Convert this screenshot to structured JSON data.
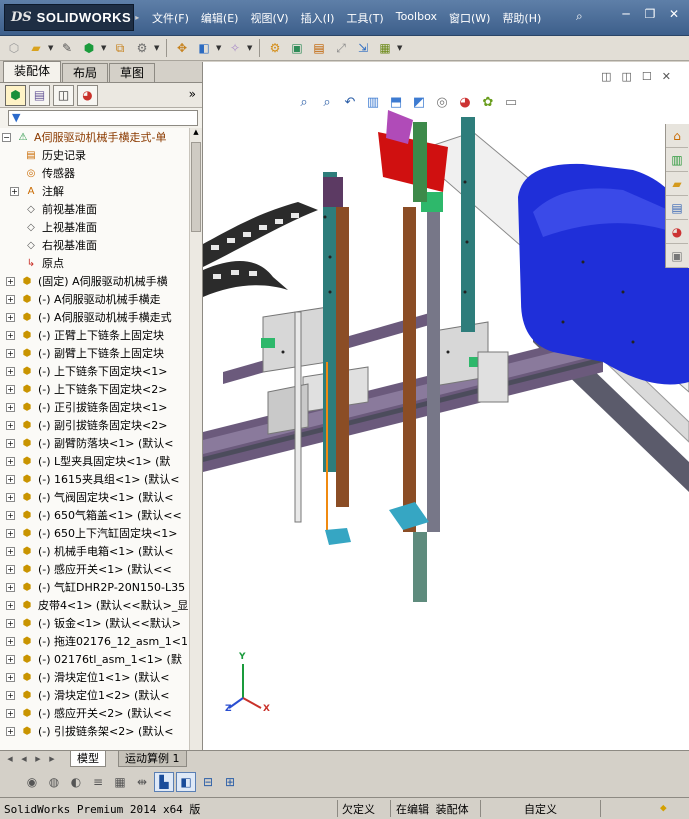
{
  "app": {
    "logo_ds": "DS",
    "logo_text": "SOLIDWORKS"
  },
  "menu": [
    "文件(F)",
    "编辑(E)",
    "视图(V)",
    "插入(I)",
    "工具(T)",
    "Toolbox",
    "窗口(W)",
    "帮助(H)"
  ],
  "panel": {
    "tabs": [
      "装配体",
      "布局",
      "草图"
    ],
    "active_tab": "装配体",
    "filter_icon": "filter-icon",
    "more": "»"
  },
  "tree": [
    {
      "label": "A伺服驱动机械手横走式-单",
      "type": "root",
      "icon": "assembly-warning-icon"
    },
    {
      "label": "历史记录",
      "type": "folder",
      "icon": "history-icon"
    },
    {
      "label": "传感器",
      "type": "folder",
      "icon": "sensor-icon"
    },
    {
      "label": "注解",
      "type": "folder",
      "icon": "annotation-icon",
      "expandable": true
    },
    {
      "label": "前视基准面",
      "type": "plane",
      "icon": "plane-icon"
    },
    {
      "label": "上视基准面",
      "type": "plane",
      "icon": "plane-icon"
    },
    {
      "label": "右视基准面",
      "type": "plane",
      "icon": "plane-icon"
    },
    {
      "label": "原点",
      "type": "origin",
      "icon": "origin-icon"
    },
    {
      "label": "(固定) A伺服驱动机械手横",
      "type": "component",
      "icon": "subassembly-icon",
      "expandable": true
    },
    {
      "label": "(-) A伺服驱动机械手横走",
      "type": "component",
      "icon": "subassembly-icon",
      "expandable": true
    },
    {
      "label": "(-) A伺服驱动机械手横走式",
      "type": "component",
      "icon": "subassembly-icon",
      "expandable": true
    },
    {
      "label": "(-) 正臂上下链条上固定块",
      "type": "component",
      "icon": "subassembly-icon",
      "expandable": true
    },
    {
      "label": "(-) 副臂上下链条上固定块",
      "type": "component",
      "icon": "subassembly-icon",
      "expandable": true
    },
    {
      "label": "(-) 上下链条下固定块<1>",
      "type": "component",
      "icon": "subassembly-icon",
      "expandable": true
    },
    {
      "label": "(-) 上下链条下固定块<2>",
      "type": "component",
      "icon": "subassembly-icon",
      "expandable": true
    },
    {
      "label": "(-) 正引拔链条固定块<1>",
      "type": "component",
      "icon": "subassembly-icon",
      "expandable": true
    },
    {
      "label": "(-) 副引拔链条固定块<2>",
      "type": "component",
      "icon": "subassembly-icon",
      "expandable": true
    },
    {
      "label": "(-) 副臂防落块<1> (默认<",
      "type": "component",
      "icon": "subassembly-icon",
      "expandable": true
    },
    {
      "label": "(-) L型夹具固定块<1> (默",
      "type": "component",
      "icon": "subassembly-icon",
      "expandable": true
    },
    {
      "label": "(-) 1615夹具组<1> (默认<",
      "type": "component",
      "icon": "subassembly-icon",
      "expandable": true
    },
    {
      "label": "(-) 气阀固定块<1> (默认<",
      "type": "component",
      "icon": "subassembly-icon",
      "expandable": true
    },
    {
      "label": "(-) 650气箱盖<1> (默认<<",
      "type": "component",
      "icon": "subassembly-icon",
      "expandable": true
    },
    {
      "label": "(-) 650上下汽缸固定块<1>",
      "type": "component",
      "icon": "subassembly-icon",
      "expandable": true
    },
    {
      "label": "(-) 机械手电箱<1> (默认<",
      "type": "component",
      "icon": "subassembly-icon",
      "expandable": true
    },
    {
      "label": "(-) 感应开关<1> (默认<<",
      "type": "component",
      "icon": "subassembly-icon",
      "expandable": true
    },
    {
      "label": "(-) 气缸DHR2P-20N150-L35",
      "type": "component",
      "icon": "subassembly-icon",
      "expandable": true
    },
    {
      "label": "皮带4<1> (默认<<默认>_显",
      "type": "component",
      "icon": "subassembly-icon",
      "expandable": true
    },
    {
      "label": "(-) 钣金<1> (默认<<默认>",
      "type": "component",
      "icon": "subassembly-icon",
      "expandable": true
    },
    {
      "label": "(-) 拖连02176_12_asm_1<1",
      "type": "component",
      "icon": "subassembly-icon",
      "expandable": true
    },
    {
      "label": "(-) 02176tl_asm_1<1> (默",
      "type": "component",
      "icon": "subassembly-icon",
      "expandable": true
    },
    {
      "label": "(-) 滑块定位1<1> (默认<",
      "type": "component",
      "icon": "subassembly-icon",
      "expandable": true
    },
    {
      "label": "(-) 滑块定位1<2> (默认<",
      "type": "component",
      "icon": "subassembly-icon",
      "expandable": true
    },
    {
      "label": "(-) 感应开关<2> (默认<<",
      "type": "component",
      "icon": "subassembly-icon",
      "expandable": true
    },
    {
      "label": "(-) 引拔链条架<2> (默认<",
      "type": "component",
      "icon": "subassembly-icon",
      "expandable": true
    }
  ],
  "bottom_tabs": [
    "模型",
    "运动算例 1"
  ],
  "active_bottom_tab": "模型",
  "triad": {
    "x": "X",
    "y": "Y",
    "z": "Z"
  },
  "status": {
    "product": "SolidWorks Premium 2014 x64 版",
    "undefined": "欠定义",
    "editing": "在编辑 装配体",
    "custom": "自定义"
  },
  "colors": {
    "titlebar": "#3d5f8b",
    "motor_blue": "#1f2fd9",
    "rail_purple": "#6b5a7c",
    "column_teal": "#2e7d7b",
    "bracket_red": "#d01010"
  }
}
